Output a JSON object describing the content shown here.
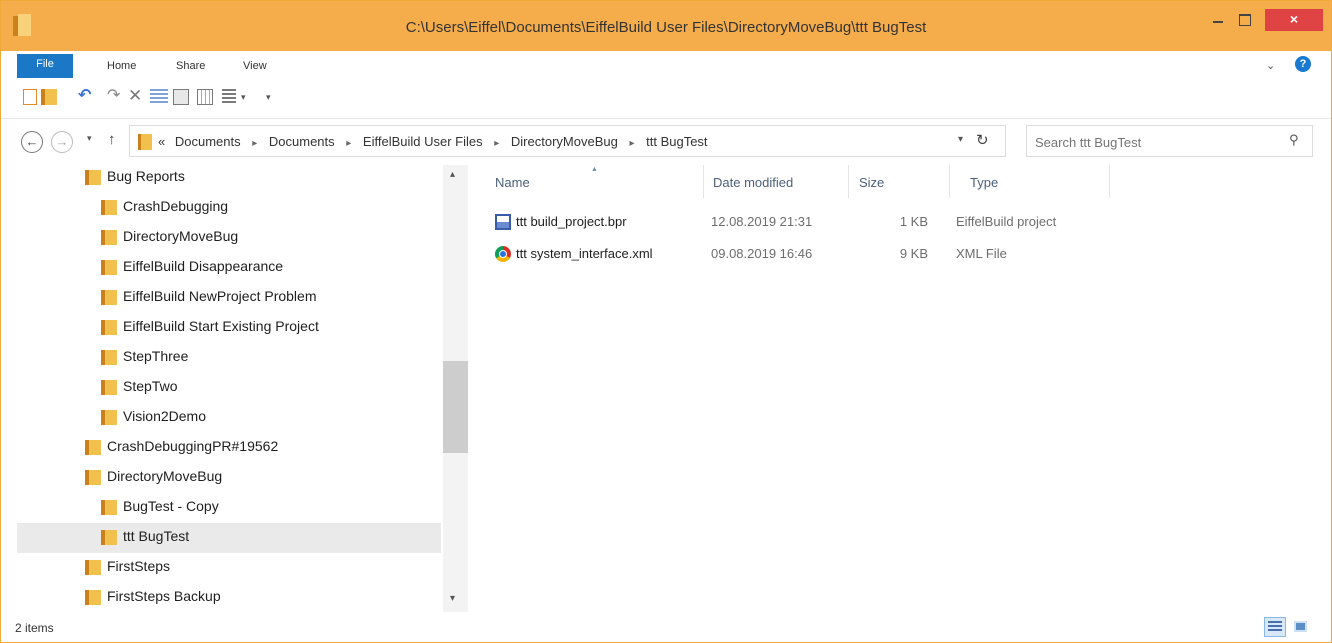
{
  "window": {
    "title": "C:\\Users\\Eiffel\\Documents\\EiffelBuild User Files\\DirectoryMoveBug\\ttt BugTest",
    "close_label": "×"
  },
  "ribbon": {
    "tabs": [
      "File",
      "Home",
      "Share",
      "View"
    ],
    "expand_label": "⌄",
    "help_label": "?"
  },
  "address": {
    "overflow_label": "«",
    "crumbs": [
      "Documents",
      "Documents",
      "EiffelBuild User Files",
      "DirectoryMoveBug",
      "ttt BugTest"
    ],
    "separator": "▸"
  },
  "search": {
    "placeholder": "Search ttt BugTest"
  },
  "nav": {
    "items": [
      {
        "label": "Bug Reports",
        "level": 1
      },
      {
        "label": "CrashDebugging",
        "level": 2
      },
      {
        "label": "DirectoryMoveBug",
        "level": 2
      },
      {
        "label": "EiffelBuild Disappearance",
        "level": 2
      },
      {
        "label": "EiffelBuild NewProject Problem",
        "level": 2
      },
      {
        "label": "EiffelBuild Start Existing Project",
        "level": 2
      },
      {
        "label": "StepThree",
        "level": 2
      },
      {
        "label": "StepTwo",
        "level": 2
      },
      {
        "label": "Vision2Demo",
        "level": 2
      },
      {
        "label": "CrashDebuggingPR#19562",
        "level": 1
      },
      {
        "label": "DirectoryMoveBug",
        "level": 1
      },
      {
        "label": "BugTest - Copy",
        "level": 2
      },
      {
        "label": "ttt BugTest",
        "level": 2,
        "selected": true
      },
      {
        "label": "FirstSteps",
        "level": 1
      },
      {
        "label": "FirstSteps Backup",
        "level": 1
      }
    ]
  },
  "details": {
    "columns": [
      "Name",
      "Date modified",
      "Size",
      "Type"
    ],
    "rows": [
      {
        "name": "ttt build_project.bpr",
        "date": "12.08.2019 21:31",
        "size": "1 KB",
        "type": "EiffelBuild project",
        "icon": "bpr-file-icon"
      },
      {
        "name": "ttt system_interface.xml",
        "date": "09.08.2019 16:46",
        "size": "9 KB",
        "type": "XML File",
        "icon": "chrome-xml-icon"
      }
    ]
  },
  "status": {
    "item_count": "2 items"
  }
}
